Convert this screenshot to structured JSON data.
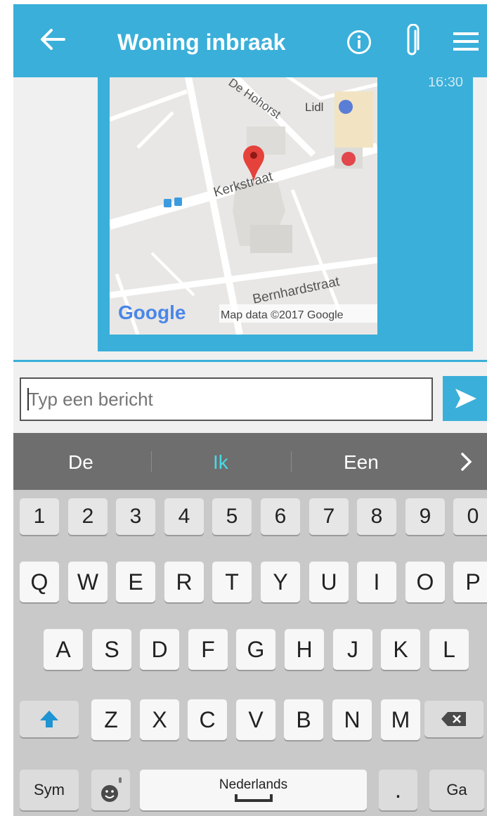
{
  "header": {
    "title": "Woning inbraak",
    "icons": [
      "back-arrow-icon",
      "info-icon",
      "paperclip-icon",
      "menu-icon"
    ],
    "color": "#3aafd9"
  },
  "message": {
    "time": "16:30",
    "map": {
      "labels": [
        "De Hohorst",
        "Lidl",
        "Kerkstraat",
        "Bernhardstraat"
      ],
      "logo": "Google",
      "attribution": "Map data ©2017 Google"
    }
  },
  "composer": {
    "placeholder": "Typ een bericht",
    "send_icon": "send-icon"
  },
  "suggestions": [
    "De",
    "Ik",
    "Een"
  ],
  "keyboard": {
    "numbers": [
      "1",
      "2",
      "3",
      "4",
      "5",
      "6",
      "7",
      "8",
      "9",
      "0"
    ],
    "row1": [
      "Q",
      "W",
      "E",
      "R",
      "T",
      "Y",
      "U",
      "I",
      "O",
      "P"
    ],
    "row2": [
      "A",
      "S",
      "D",
      "F",
      "G",
      "H",
      "J",
      "K",
      "L"
    ],
    "row3": [
      "Z",
      "X",
      "C",
      "V",
      "B",
      "N",
      "M"
    ],
    "sym": "Sym",
    "space": "Nederlands",
    "period": ".",
    "go": "Ga"
  }
}
